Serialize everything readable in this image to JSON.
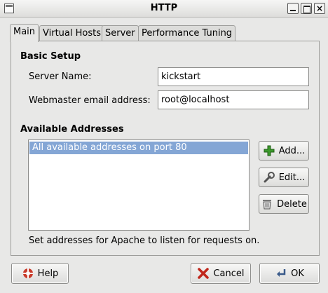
{
  "window": {
    "title": "HTTP"
  },
  "tabs": [
    {
      "label": "Main",
      "active": true
    },
    {
      "label": "Virtual Hosts",
      "active": false
    },
    {
      "label": "Server",
      "active": false
    },
    {
      "label": "Performance Tuning",
      "active": false
    }
  ],
  "basic_setup": {
    "heading": "Basic Setup",
    "server_name_label": "Server Name:",
    "server_name_value": "kickstart",
    "webmaster_label": "Webmaster email address:",
    "webmaster_value": "root@localhost"
  },
  "addresses": {
    "heading": "Available Addresses",
    "items": [
      "All available addresses on port 80"
    ],
    "selected_index": 0,
    "add_label": "Add...",
    "edit_label": "Edit...",
    "delete_label": "Delete",
    "hint": "Set addresses for Apache to listen for requests on."
  },
  "footer": {
    "help_label": "Help",
    "cancel_label": "Cancel",
    "ok_label": "OK"
  },
  "colors": {
    "selection": "#84a6d5",
    "window_bg": "#e8e8e7",
    "add_icon": "#3c9a2c",
    "cancel_icon": "#c0271c"
  }
}
